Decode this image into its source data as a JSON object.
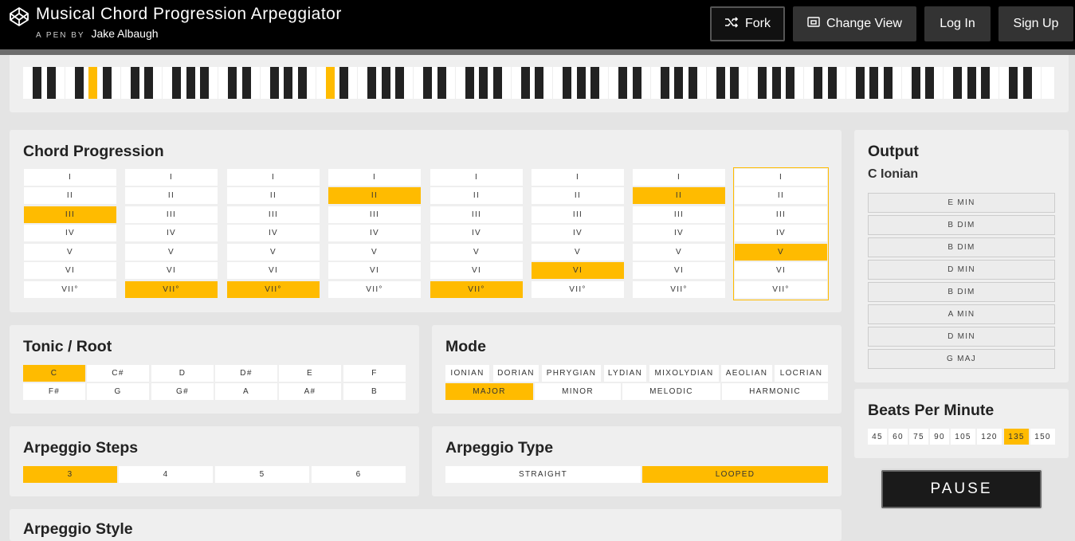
{
  "header": {
    "title": "Musical Chord Progression Arpeggiator",
    "byline_prefix": "A PEN BY",
    "author": "Jake Albaugh",
    "fork_label": "Fork",
    "change_view_label": "Change View",
    "login_label": "Log In",
    "signup_label": "Sign Up"
  },
  "keyboard": {
    "white_keys": 74,
    "active_white": [],
    "active_black": [
      3,
      15
    ]
  },
  "progression": {
    "title": "Chord Progression",
    "degrees": [
      "I",
      "ii",
      "iii",
      "IV",
      "V",
      "vi",
      "vii°"
    ],
    "columns": [
      {
        "selected": 2
      },
      {
        "selected": 6
      },
      {
        "selected": 6
      },
      {
        "selected": 1
      },
      {
        "selected": 6
      },
      {
        "selected": 5
      },
      {
        "selected": 1
      },
      {
        "selected": 4,
        "current": true
      }
    ]
  },
  "tonic": {
    "title": "Tonic / Root",
    "notes": [
      "C",
      "C#",
      "D",
      "D#",
      "E",
      "F",
      "F#",
      "G",
      "G#",
      "A",
      "A#",
      "B"
    ],
    "selected": "C"
  },
  "mode": {
    "title": "Mode",
    "modes": [
      "IONIAN",
      "DORIAN",
      "PHRYGIAN",
      "LYDIAN",
      "MIXOLYDIAN",
      "AEOLIAN",
      "LOCRIAN"
    ],
    "scales": [
      "MAJOR",
      "MINOR",
      "MELODIC",
      "HARMONIC"
    ],
    "selected_scale": "MAJOR"
  },
  "arp_steps": {
    "title": "Arpeggio Steps",
    "options": [
      "3",
      "4",
      "5",
      "6"
    ],
    "selected": "3"
  },
  "arp_type": {
    "title": "Arpeggio Type",
    "options": [
      "STRAIGHT",
      "LOOPED"
    ],
    "selected": "LOOPED"
  },
  "arp_style": {
    "title": "Arpeggio Style"
  },
  "output": {
    "title": "Output",
    "key": "C Ionian",
    "chords": [
      "E MIN",
      "B DIM",
      "B DIM",
      "D MIN",
      "B DIM",
      "A MIN",
      "D MIN",
      "G MAJ"
    ]
  },
  "bpm": {
    "title": "Beats Per Minute",
    "options": [
      "45",
      "60",
      "75",
      "90",
      "105",
      "120",
      "135",
      "150"
    ],
    "selected": "135"
  },
  "pause_label": "PAUSE",
  "colors": {
    "accent": "#ffbb00",
    "header": "#000000"
  }
}
